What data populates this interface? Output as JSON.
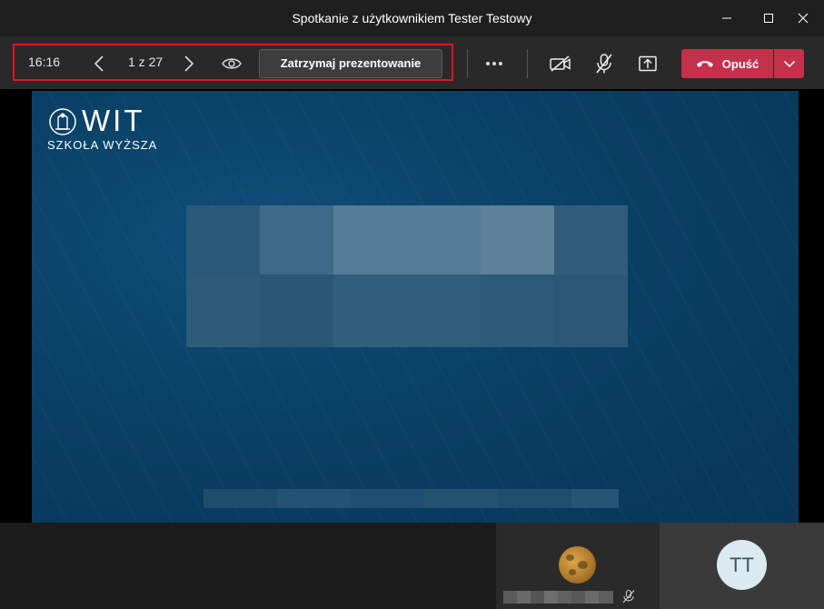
{
  "window": {
    "title": "Spotkanie z użytkownikiem Tester Testowy",
    "controls": [
      "minimize-icon",
      "maximize-icon",
      "close-icon"
    ]
  },
  "toolbar": {
    "timer": "16:16",
    "slide_counter": "1 z 27",
    "stop_presenting_label": "Zatrzymaj prezentowanie",
    "leave_label": "Opuść",
    "icons": [
      "chevron-left-icon",
      "chevron-right-icon",
      "eye-icon",
      "more-icon",
      "camera-off-icon",
      "mic-off-icon",
      "share-tray-icon",
      "hang-up-icon",
      "chevron-down-icon"
    ],
    "colors": {
      "leave": "#c4314b",
      "highlight_border": "#e0151d"
    }
  },
  "slide": {
    "logo_text": "WIT",
    "logo_subtitle": "SZKOŁA WYŻSZA",
    "content_obscured": true,
    "background_color": "#0a4066"
  },
  "participants": [
    {
      "avatar": "moon-photo",
      "name_obscured": true,
      "muted": true
    },
    {
      "initials": "TT"
    }
  ]
}
